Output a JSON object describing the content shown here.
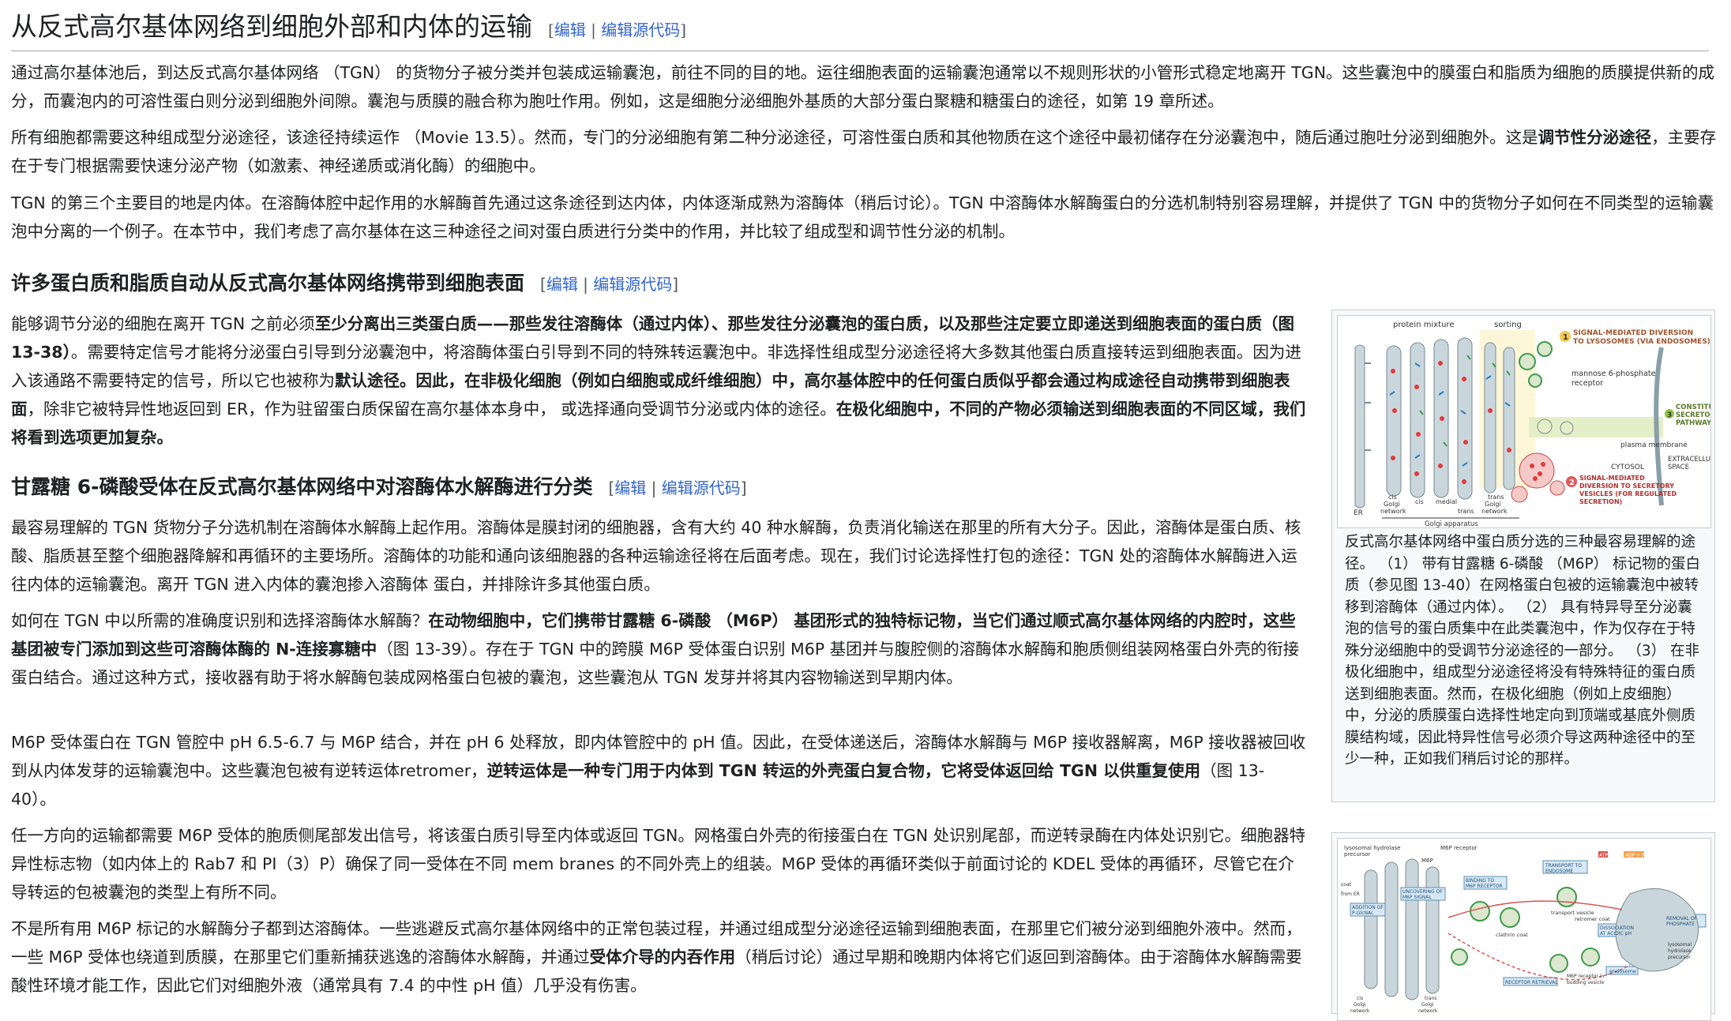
{
  "section": {
    "title": "从反式高尔基体网络到细胞外部和内体的运输",
    "edit_open": "[",
    "edit": "编辑",
    "sep": " | ",
    "edit_source": "编辑源代码",
    "edit_close": "]"
  },
  "intro": {
    "p1": "通过高尔基体池后，到达反式高尔基体网络 （TGN） 的货物分子被分类并包装成运输囊泡，前往不同的目的地。运往细胞表面的运输囊泡通常以不规则形状的小管形式稳定地离开 TGN。这些囊泡中的膜蛋白和脂质为细胞的质膜提供新的成分，而囊泡内的可溶性蛋白则分泌到细胞外间隙。囊泡与质膜的融合称为胞吐作用。例如，这是细胞分泌细胞外基质的大部分蛋白聚糖和糖蛋白的途径，如第 19 章所述。",
    "p2_a": "所有细胞都需要这种组成型分泌途径，该途径持续运作 （Movie 13.5）。然而，专门的分泌细胞有第二种分泌途径，可溶性蛋白质和其他物质在这个途径中最初储存在分泌囊泡中，随后通过胞吐分泌到细胞外。这是",
    "p2_b": "调节性分泌途径",
    "p2_c": "，主要存在于专门根据需要快速分泌产物（如激素、神经递质或消化酶）的细胞中。",
    "p3": "TGN 的第三个主要目的地是内体。在溶酶体腔中起作用的水解酶首先通过这条途径到达内体，内体逐渐成熟为溶酶体（稍后讨论）。TGN 中溶酶体水解酶蛋白的分选机制特别容易理解，并提供了 TGN 中的货物分子如何在不同类型的运输囊泡中分离的一个例子。在本节中，我们考虑了高尔基体在这三种途径之间对蛋白质进行分类中的作用，并比较了组成型和调节性分泌的机制。"
  },
  "section2": {
    "title": "许多蛋白质和脂质自动从反式高尔基体网络携带到细胞表面",
    "p1_a": "能够调节分泌的细胞在离开 TGN 之前必须",
    "p1_b": "至少分离出三类蛋白质——那些发往溶酶体（通过内体）、那些发往分泌囊泡的蛋白质，以及那些注定要立即递送到细胞表面的蛋白质（图 13-38）",
    "p1_c": "。需要特定信号才能将分泌蛋白引导到分泌囊泡中，将溶酶体蛋白引导到不同的特殊转运囊泡中。非选择性组成型分泌途径将大多数其他蛋白质直接转运到细胞表面。因为进入该通路不需要特定的信号，所以它也被称为",
    "p1_d": "默认途径",
    "p1_e": "。因此，在非极化细胞（例如白细胞或成纤维细胞）中，高尔基体腔中的任何蛋白质似乎都会通过构成途径自动携带到细胞表面",
    "p1_f": "，除非它被特异性地返回到 ER，作为驻留蛋白质保留在高尔基体本身中， 或选择通向受调节分泌或内体的途径。",
    "p1_g": "在极化细胞中，不同的产物必须输送到细胞表面的不同区域，我们将看到选项更加复杂。"
  },
  "section3": {
    "title": "甘露糖 6-磷酸受体在反式高尔基体网络中对溶酶体水解酶进行分类",
    "p1": "最容易理解的 TGN 货物分子分选机制在溶酶体水解酶上起作用。溶酶体是膜封闭的细胞器，含有大约 40 种水解酶，负责消化输送在那里的所有大分子。因此，溶酶体是蛋白质、核酸、脂质甚至整个细胞器降解和再循环的主要场所。溶酶体的功能和通向该细胞器的各种运输途径将在后面考虑。现在，我们讨论选择性打包的途径：TGN 处的溶酶体水解酶进入运往内体的运输囊泡。离开 TGN 进入内体的囊泡掺入溶酶体 蛋白，并排除许多其他蛋白质。",
    "p2_a": "如何在 TGN 中以所需的准确度识别和选择溶酶体水解酶？",
    "p2_b": "在动物细胞中，它们携带甘露糖 6-磷酸 （M6P） 基团形式的独特标记物，当它们通过顺式高尔基体网络的内腔时，这些基团被专门添加到这些可溶酶体酶的 N-连接寡糖中",
    "p2_c": "（图 13-39）。存在于 TGN 中的跨膜 M6P 受体蛋白识别 M6P 基团并与腹腔侧的溶酶体水解酶和胞质侧组装网格蛋白外壳的衔接蛋白结合。通过这种方式，接收器有助于将水解酶包装成网格蛋白包被的囊泡，这些囊泡从 TGN 发芽并将其内容物输送到早期内体。",
    "p3_a": "M6P 受体蛋白在 TGN 管腔中 pH 6.5-6.7 与 M6P 结合，并在 pH 6 处释放，即内体管腔中的 pH 值。因此，在受体递送后，溶酶体水解酶与 M6P 接收器解离，M6P 接收器被回收到从内体发芽的运输囊泡中。这些囊泡包被有逆转运体retromer，",
    "p3_b": "逆转运体是一种专门用于内体到 TGN 转运的外壳蛋白复合物，它将受体返回给 TGN 以供重复使用",
    "p3_c": "（图 13-40）。",
    "p4": "任一方向的运输都需要 M6P 受体的胞质侧尾部发出信号，将该蛋白质引导至内体或返回 TGN。网格蛋白外壳的衔接蛋白在 TGN 处识别尾部，而逆转录酶在内体处识别它。细胞器特异性标志物（如内体上的 Rab7 和 PI（3）P）确保了同一受体在不同 mem branes 的不同外壳上的组装。M6P 受体的再循环类似于前面讨论的 KDEL 受体的再循环，尽管它在介导转运的包被囊泡的类型上有所不同。",
    "p5_a": "不是所有用 M6P 标记的水解酶分子都到达溶酶体。一些逃避反式高尔基体网络中的正常包装过程，并通过组成型分泌途径运输到细胞表面，在那里它们被分泌到细胞外液中。然而，一些 M6P 受体也绕道到质膜，在那里它们重新捕获逃逸的溶酶体水解酶，并通过",
    "p5_b": "受体介导的内吞作用",
    "p5_c": "（稍后讨论）通过早期和晚期内体将它们返回到溶酶体。由于溶酶体水解酶需要酸性环境才能工作，因此它们对细胞外液（通常具有 7.4 的中性 pH 值）几乎没有伤害。"
  },
  "figure1": {
    "caption": "反式高尔基体网络中蛋白质分选的三种最容易理解的途径。 （1） 带有甘露糖 6-磷酸 （M6P） 标记物的蛋白质（参见图 13-40）在网格蛋白包被的运输囊泡中被转移到溶酶体（通过内体）。 （2） 具有特异导至分泌囊泡的信号的蛋白质集中在此类囊泡中，作为仅存在于特殊分泌细胞中的受调节分泌途径的一部分。 （3） 在非极化细胞中，组成型分泌途径将没有特殊特征的蛋白质送到细胞表面。然而，在极化细胞（例如上皮细胞）中，分泌的质膜蛋白选择性地定向到顶端或基底外侧质膜结构域，因此特异性信号必须介导这两种途径中的至少一种，正如我们稍后讨论的那样。",
    "labels": {
      "protein_mixture": "protein mixture",
      "sorting": "sorting",
      "l1a": "SIGNAL-MEDIATED DIVERSION",
      "l1b": "TO LYSOSOMES (VIA ENDOSOMES)",
      "m6p_a": "mannose 6-phosphate",
      "m6p_b": "receptor",
      "l3a": "CONSTITUTIVE",
      "l3b": "SECRETORY",
      "l3c": "PATHWAY",
      "plasma": "plasma membrane",
      "extra_a": "EXTRACELLULAR",
      "extra_b": "SPACE",
      "cytosol": "CYTOSOL",
      "l2a": "SIGNAL-MEDIATED",
      "l2b": "DIVERSION TO SECRETORY",
      "l2c": "VESICLES (FOR REGULATED",
      "l2d": "SECRETION)",
      "er": "ER",
      "cis_a": "cis",
      "cis_b": "Golgi",
      "cis_c": "network",
      "cis2": "cis",
      "medial": "medial",
      "trans_a": "trans",
      "trans_b": "trans",
      "trans_c": "Golgi",
      "trans_d": "network",
      "golgi_app": "Golgi apparatus",
      "n1": "1",
      "n2": "2",
      "n3": "3"
    }
  },
  "figure2": {
    "labels": {
      "lys_hyd": "lysosomal hydrolase",
      "precursor": "precursor",
      "m6p_receptor": "M6P receptor",
      "m6p": "M6P",
      "transport_a": "TRANSPORT TO",
      "transport_b": "ENDOSOME",
      "addition_a": "ADDITION OF",
      "addition_b": "P-GlcNAc",
      "uncover_a": "UNCOVERING OF",
      "uncover_b": "M6P SIGNAL",
      "binding_a": "BINDING TO",
      "binding_b": "M6P RECEPTOR",
      "clathrin": "clathrin coat",
      "transport_vesicle": "transport vesicle",
      "dissociation_a": "DISSOCIATION",
      "dissociation_b": "AT ACIDIC pH",
      "removal_a": "REMOVAL OF",
      "removal_b": "PHOSPHATE",
      "atp": "ATP",
      "adp": "ADP + Pi",
      "retromer": "retromer coat",
      "receptor_retrieval": "RECEPTOR RETRIEVAL",
      "m6p_budding_a": "M6P receptor in",
      "m6p_budding_b": "budding vesicle",
      "endosome": "endosome",
      "lyso_a": "lysosomal",
      "lyso_b": "hydrolase",
      "lyso_c": "precursor",
      "cis_a": "cis",
      "cis_b": "Golgi",
      "cis_c": "network",
      "trans_a": "trans",
      "trans_b": "Golgi",
      "trans_c": "network",
      "from_er": "from ER",
      "coat": "coat"
    }
  }
}
